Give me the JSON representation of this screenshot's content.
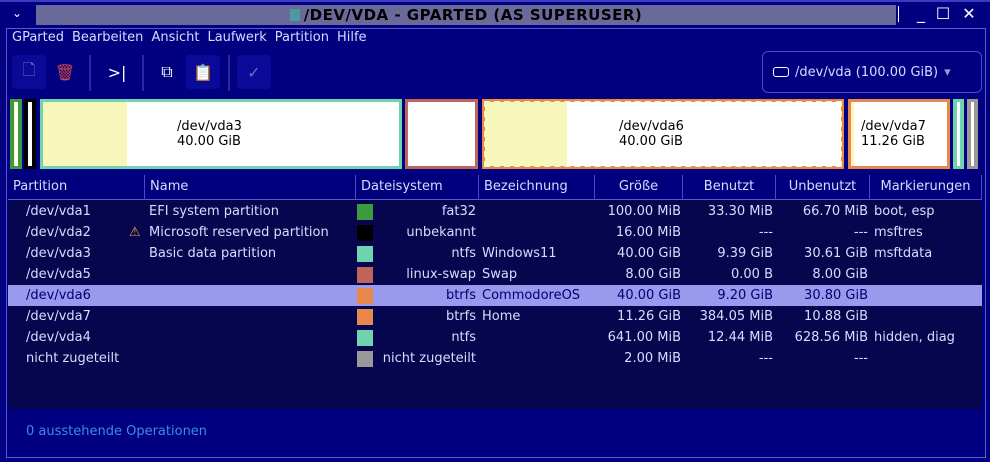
{
  "window": {
    "title": "/DEV/VDA - GPARTED (AS SUPERUSER)",
    "collapse": "⌄",
    "minimize": "_",
    "maximize": "☐",
    "close": "✕"
  },
  "menu": [
    "GParted",
    "Bearbeiten",
    "Ansicht",
    "Laufwerk",
    "Partition",
    "Hilfe"
  ],
  "toolbar": {
    "new": "🗋",
    "delete": "🗑",
    "resize": ">|",
    "copy": "⧉",
    "paste": "📋",
    "apply": "✓"
  },
  "device": {
    "label": "/dev/vda (100.00 GiB)",
    "arrow": "▾"
  },
  "diskmap": [
    {
      "name": "",
      "color": "#3d9a3d",
      "used": 0.33
    },
    {
      "name": "",
      "color": "#000000",
      "used": 0
    },
    {
      "name": "/dev/vda3",
      "size": "40.00 GiB",
      "color": "#6fd3b0",
      "used": 0.235
    },
    {
      "name": "",
      "size": "",
      "color": "#c0655a",
      "used": 0
    },
    {
      "name": "/dev/vda6",
      "size": "40.00 GiB",
      "color": "#e8884a",
      "used": 0.23,
      "selected": true
    },
    {
      "name": "/dev/vda7",
      "size": "11.26 GiB",
      "color": "#e8884a",
      "used": 0.03
    },
    {
      "name": "",
      "color": "#6fd3b0",
      "used": 0.02
    },
    {
      "name": "",
      "color": "#999999",
      "used": 0
    }
  ],
  "columns": [
    "Partition",
    "Name",
    "Dateisystem",
    "Bezeichnung",
    "Größe",
    "Benutzt",
    "Unbenutzt",
    "Markierungen"
  ],
  "rows": [
    {
      "partition": "/dev/vda1",
      "name": "EFI system partition",
      "fs": "fat32",
      "fs_color": "#3d9a3d",
      "label": "",
      "size": "100.00 MiB",
      "used": "33.30 MiB",
      "unused": "66.70 MiB",
      "flags": "boot, esp"
    },
    {
      "partition": "/dev/vda2",
      "warning": "⚠",
      "name": "Microsoft reserved partition",
      "fs": "unbekannt",
      "fs_color": "#000000",
      "label": "",
      "size": "16.00 MiB",
      "used": "---",
      "unused": "---",
      "flags": "msftres"
    },
    {
      "partition": "/dev/vda3",
      "name": "Basic data partition",
      "fs": "ntfs",
      "fs_color": "#6fd3b0",
      "label": "Windows11",
      "size": "40.00 GiB",
      "used": "9.39 GiB",
      "unused": "30.61 GiB",
      "flags": "msftdata"
    },
    {
      "partition": "/dev/vda5",
      "name": "",
      "fs": "linux-swap",
      "fs_color": "#c0655a",
      "label": "Swap",
      "size": "8.00 GiB",
      "used": "0.00 B",
      "unused": "8.00 GiB",
      "flags": ""
    },
    {
      "partition": "/dev/vda6",
      "name": "",
      "fs": "btrfs",
      "fs_color": "#e8884a",
      "label": "CommodoreOS",
      "size": "40.00 GiB",
      "used": "9.20 GiB",
      "unused": "30.80 GiB",
      "flags": "",
      "selected": true
    },
    {
      "partition": "/dev/vda7",
      "name": "",
      "fs": "btrfs",
      "fs_color": "#e8884a",
      "label": "Home",
      "size": "11.26 GiB",
      "used": "384.05 MiB",
      "unused": "10.88 GiB",
      "flags": ""
    },
    {
      "partition": "/dev/vda4",
      "name": "",
      "fs": "ntfs",
      "fs_color": "#6fd3b0",
      "label": "",
      "size": "641.00 MiB",
      "used": "12.44 MiB",
      "unused": "628.56 MiB",
      "flags": "hidden, diag"
    },
    {
      "partition": "nicht zugeteilt",
      "name": "",
      "fs": "nicht zugeteilt",
      "fs_color": "#999999",
      "label": "",
      "size": "2.00 MiB",
      "used": "---",
      "unused": "---",
      "flags": ""
    }
  ],
  "status": "0 ausstehende Operationen"
}
